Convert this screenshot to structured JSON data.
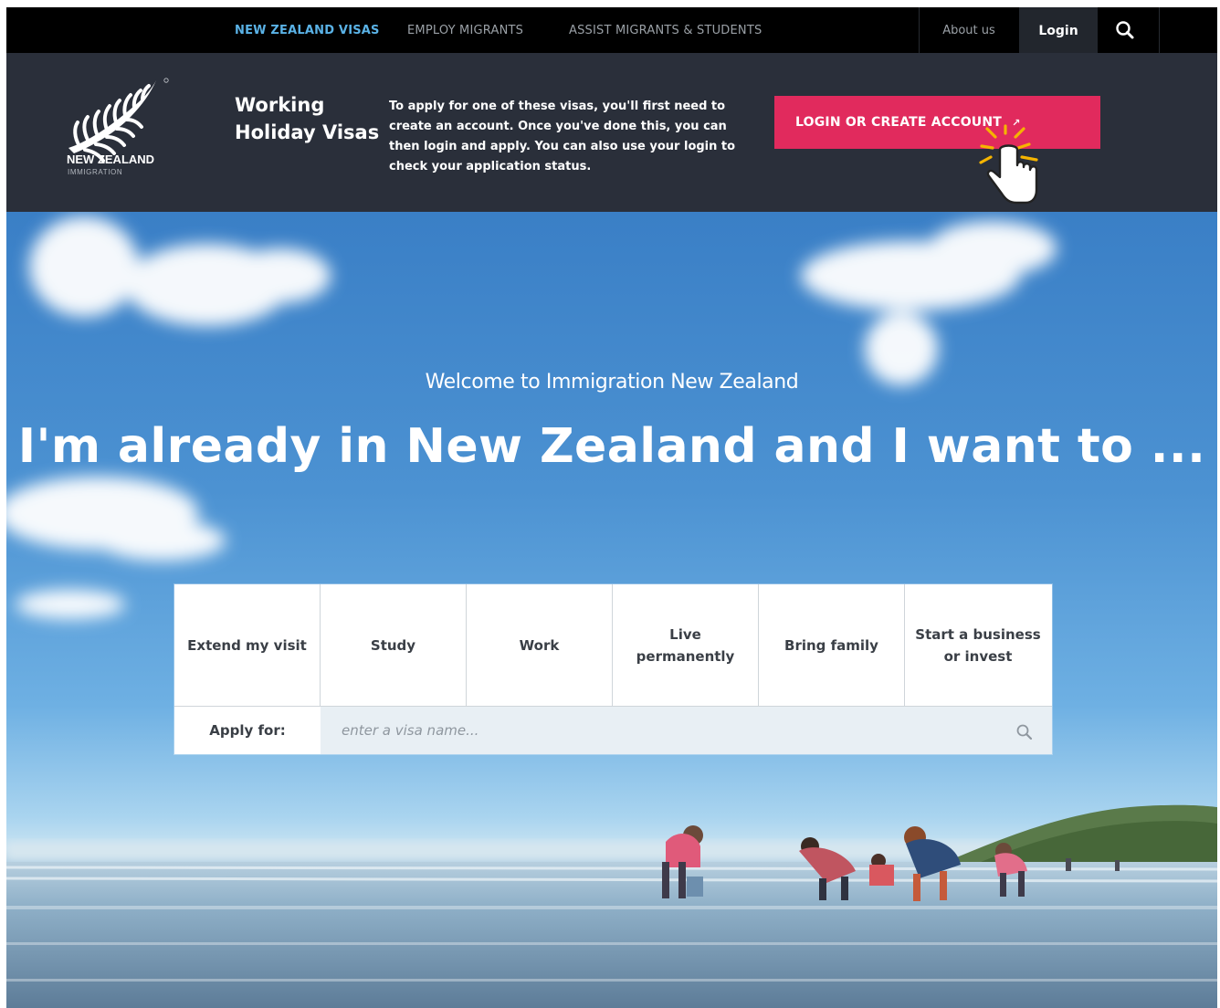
{
  "topnav": {
    "links": [
      {
        "label": "NEW ZEALAND VISAS",
        "active": true
      },
      {
        "label": "EMPLOY MIGRANTS",
        "active": false
      },
      {
        "label": "ASSIST MIGRANTS & STUDENTS",
        "active": false
      }
    ],
    "about": "About us",
    "login": "Login",
    "search_icon": "search-icon"
  },
  "header": {
    "logo_name": "NEW ZEALAND",
    "logo_sub": "IMMIGRATION",
    "title": "Working Holiday Visas",
    "description": "To apply for one of these visas, you'll first need to create an account. Once you've done this, you can then login and apply. You can also use your login to check your application status.",
    "cta_label": "LOGIN OR CREATE ACCOUNT",
    "cta_icon": "external-link-icon"
  },
  "hero": {
    "welcome": "Welcome to Immigration New Zealand",
    "headline": "I'm already in New Zealand and I want to ...",
    "options": [
      "Extend my visit",
      "Study",
      "Work",
      "Live permanently",
      "Bring family",
      "Start a business or invest"
    ],
    "apply_label": "Apply for:",
    "apply_placeholder": "enter a visa name..."
  },
  "colors": {
    "nav_active": "#5ab2e6",
    "header_bg": "#2a2f3a",
    "cta": "#e12a5d",
    "sky": "#4c92d2"
  }
}
